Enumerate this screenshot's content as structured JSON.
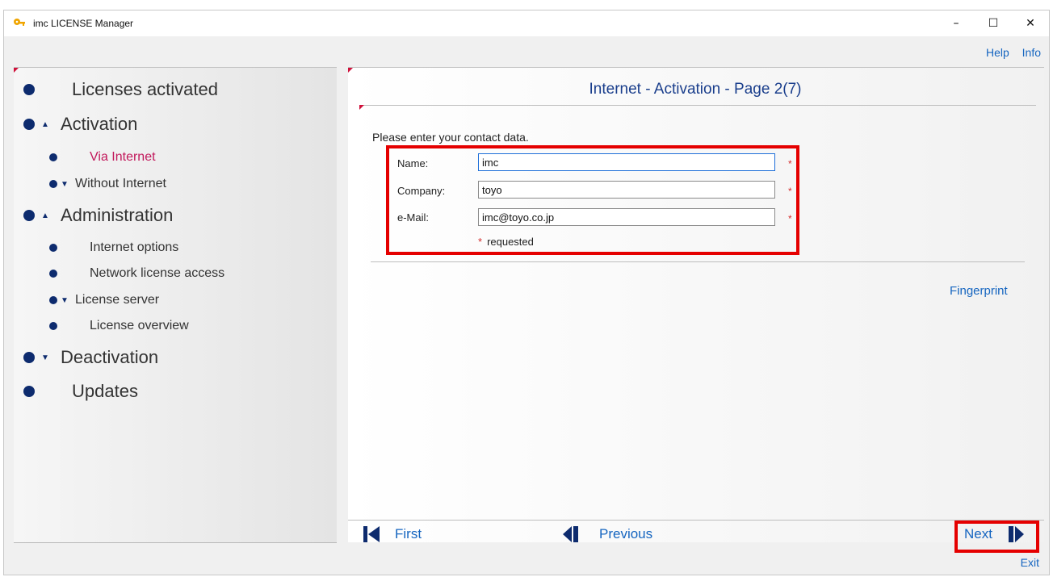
{
  "window": {
    "title": "imc LICENSE Manager",
    "controls": {
      "minimize": "–",
      "maximize": "☐",
      "close": "✕"
    }
  },
  "menu": {
    "help": "Help",
    "info": "Info"
  },
  "sidebar": {
    "items": [
      {
        "label": "Licenses activated",
        "level": 1,
        "arrow": ""
      },
      {
        "label": "Activation",
        "level": 1,
        "arrow": "▲"
      },
      {
        "label": "Via Internet",
        "level": 2,
        "arrow": "",
        "active": true
      },
      {
        "label": "Without Internet",
        "level": 2,
        "arrow": "▼"
      },
      {
        "label": "Administration",
        "level": 1,
        "arrow": "▲"
      },
      {
        "label": "Internet options",
        "level": 2,
        "arrow": ""
      },
      {
        "label": "Network license access",
        "level": 2,
        "arrow": ""
      },
      {
        "label": "License server",
        "level": 2,
        "arrow": "▼"
      },
      {
        "label": "License overview",
        "level": 2,
        "arrow": ""
      },
      {
        "label": "Deactivation",
        "level": 1,
        "arrow": "▼"
      },
      {
        "label": "Updates",
        "level": 1,
        "arrow": ""
      }
    ]
  },
  "content": {
    "title": "Internet - Activation - Page 2(7)",
    "intro": "Please enter your contact data.",
    "form": {
      "name_label": "Name:",
      "name_value": "imc",
      "company_label": "Company:",
      "company_value": "toyo",
      "email_label": "e-Mail:",
      "email_value": "imc@toyo.co.jp",
      "required_star": "*",
      "required_note": "requested"
    },
    "fingerprint": "Fingerprint"
  },
  "navigation": {
    "first": "First",
    "previous": "Previous",
    "next": "Next"
  },
  "exit": "Exit",
  "colors": {
    "link": "#1565c0",
    "active": "#c2185b",
    "bullet": "#0d2b6e",
    "highlight": "#e50000"
  }
}
